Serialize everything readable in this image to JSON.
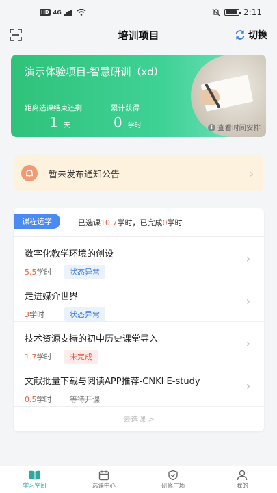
{
  "status_bar": {
    "network": "4G",
    "time": "2:11"
  },
  "header": {
    "title": "培训项目",
    "switch_label": "切换"
  },
  "hero": {
    "title": "演示体验项目-智慧研训（xd）",
    "countdown_label": "距离选课结束还剩",
    "countdown_value": "1",
    "countdown_unit": "天",
    "earned_label": "累计获得",
    "earned_value": "0",
    "earned_unit": "学时",
    "schedule_link": "查看时间安排"
  },
  "notice": {
    "text": "暂未发布通知公告"
  },
  "courses": {
    "tag": "课程选学",
    "summary_prefix": "已选课",
    "selected_hours": "10.7",
    "summary_mid": "学时，已完成",
    "completed_hours": "0",
    "summary_suffix": "学时",
    "items": [
      {
        "name": "数字化教学环境的创设",
        "hours": "5.5",
        "unit": "学时",
        "status": "状态异常"
      },
      {
        "name": "走进媒介世界",
        "hours": "3",
        "unit": "学时",
        "status": "状态异常"
      },
      {
        "name": "技术资源支持的初中历史课堂导入",
        "hours": "1.7",
        "unit": "学时",
        "status": "未完成"
      },
      {
        "name": "文献批量下载与阅读APP推荐-CNKI E-study",
        "hours": "0.5",
        "unit": "学时",
        "status": "等待开课"
      }
    ],
    "more_link": "去选课 >"
  },
  "tabs": [
    {
      "label": "学习空间",
      "icon": "book-icon",
      "active": true
    },
    {
      "label": "选课中心",
      "icon": "calendar-icon",
      "active": false
    },
    {
      "label": "研修广场",
      "icon": "shield-icon",
      "active": false
    },
    {
      "label": "我的",
      "icon": "person-icon",
      "active": false
    }
  ],
  "colors": {
    "hero_green": "#2fc27a",
    "accent_blue": "#4b8af0",
    "highlight_red": "#f0603a",
    "active_tab": "#2fa8a0"
  }
}
